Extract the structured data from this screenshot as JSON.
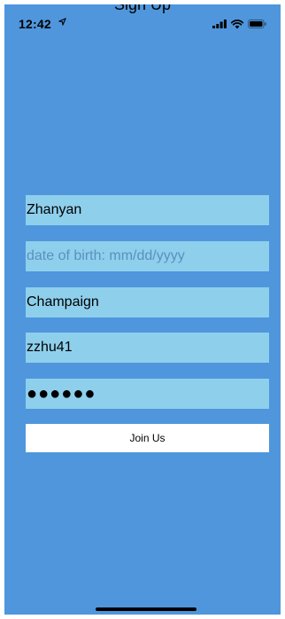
{
  "status_bar": {
    "time": "12:42"
  },
  "nav": {
    "title": "Sign Up"
  },
  "form": {
    "name_value": "Zhanyan",
    "dob_placeholder": "date of birth: mm/dd/yyyy",
    "city_value": "Champaign",
    "username_value": "zzhu41",
    "password_masked": "●●●●●●"
  },
  "actions": {
    "join_label": "Join Us"
  },
  "icons": {
    "location": "location-arrow-icon",
    "signal": "cellular-signal-icon",
    "wifi": "wifi-icon",
    "battery": "battery-icon"
  },
  "colors": {
    "background": "#4f96dc",
    "field_background": "#8ecfec",
    "button_background": "#ffffff",
    "placeholder_text": "#5c8fbf"
  }
}
